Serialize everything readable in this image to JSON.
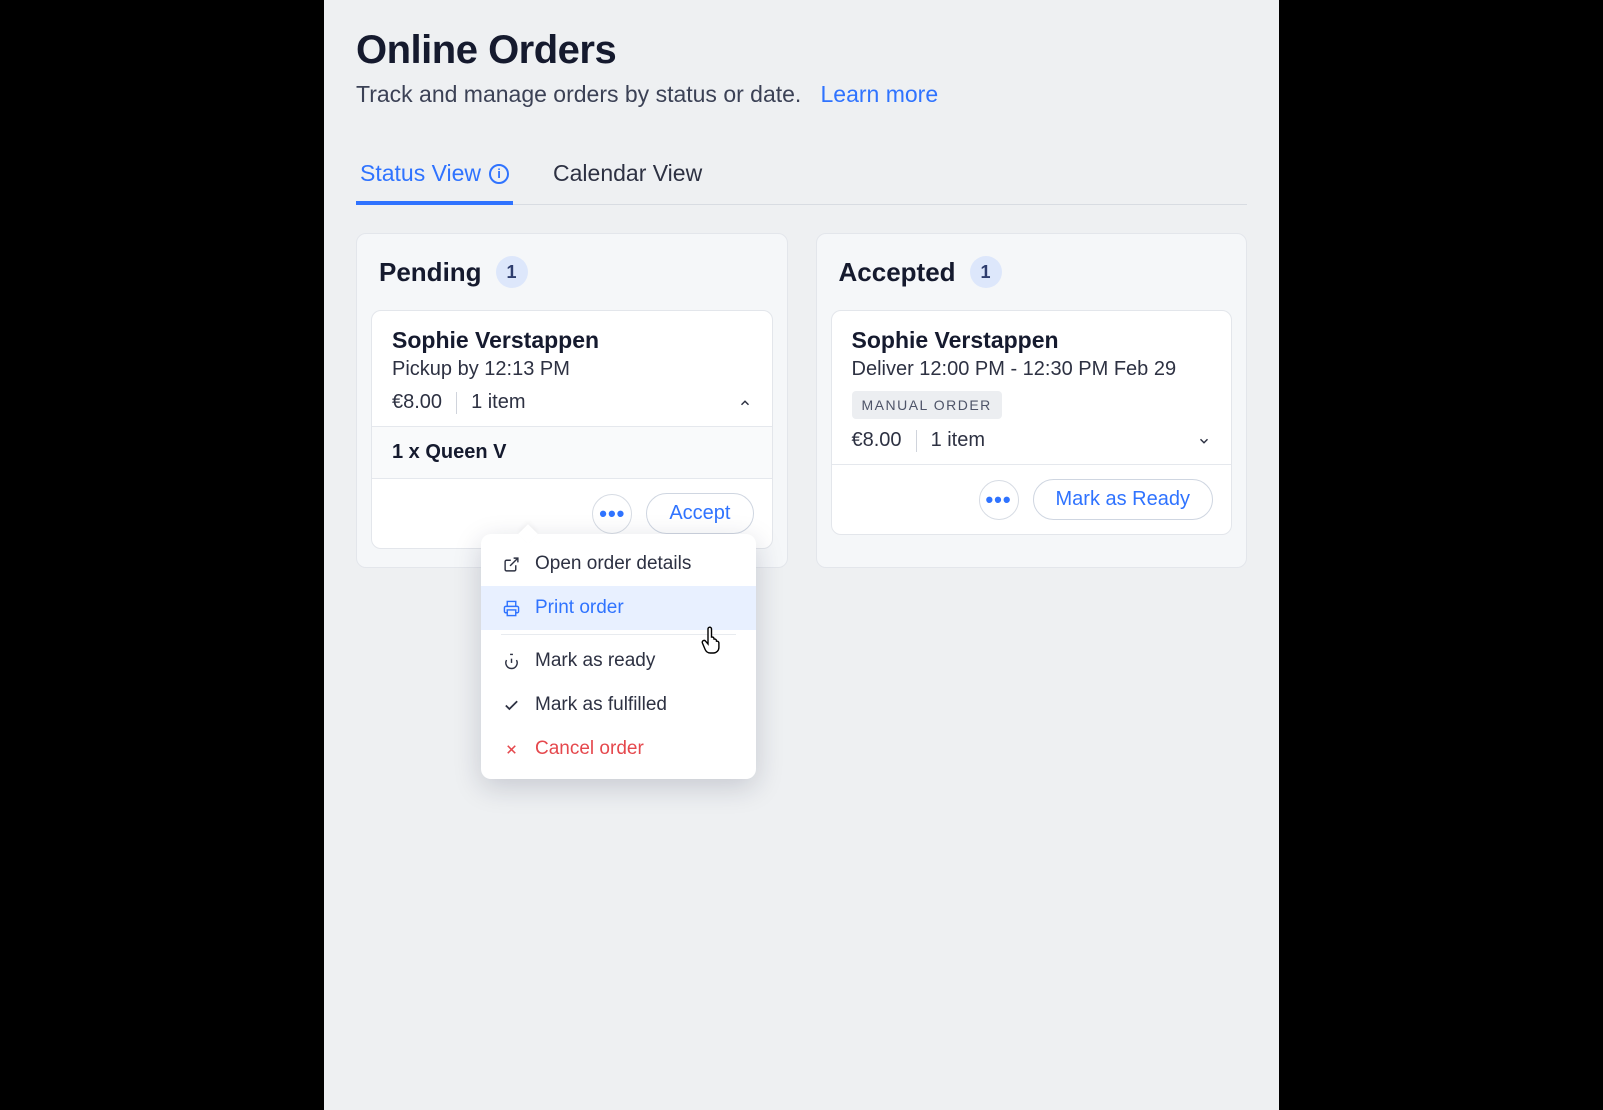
{
  "header": {
    "title": "Online Orders",
    "subtitle": "Track and manage orders by status or date.",
    "learn_more": "Learn more"
  },
  "tabs": {
    "status": "Status View",
    "calendar": "Calendar View"
  },
  "columns": {
    "pending": {
      "title": "Pending",
      "count": "1"
    },
    "accepted": {
      "title": "Accepted",
      "count": "1"
    }
  },
  "cards": {
    "pending": {
      "name": "Sophie Verstappen",
      "fulfil": "Pickup by 12:13 PM",
      "price": "€8.00",
      "items": "1 item",
      "line_item": "1 x Queen V",
      "accept_label": "Accept"
    },
    "accepted": {
      "name": "Sophie Verstappen",
      "fulfil": "Deliver 12:00 PM - 12:30 PM Feb 29",
      "tag": "MANUAL ORDER",
      "price": "€8.00",
      "items": "1 item",
      "ready_label": "Mark as Ready"
    }
  },
  "dropdown": {
    "open_details": "Open order details",
    "print": "Print order",
    "mark_ready": "Mark as ready",
    "mark_fulfilled": "Mark as fulfilled",
    "cancel": "Cancel order"
  }
}
